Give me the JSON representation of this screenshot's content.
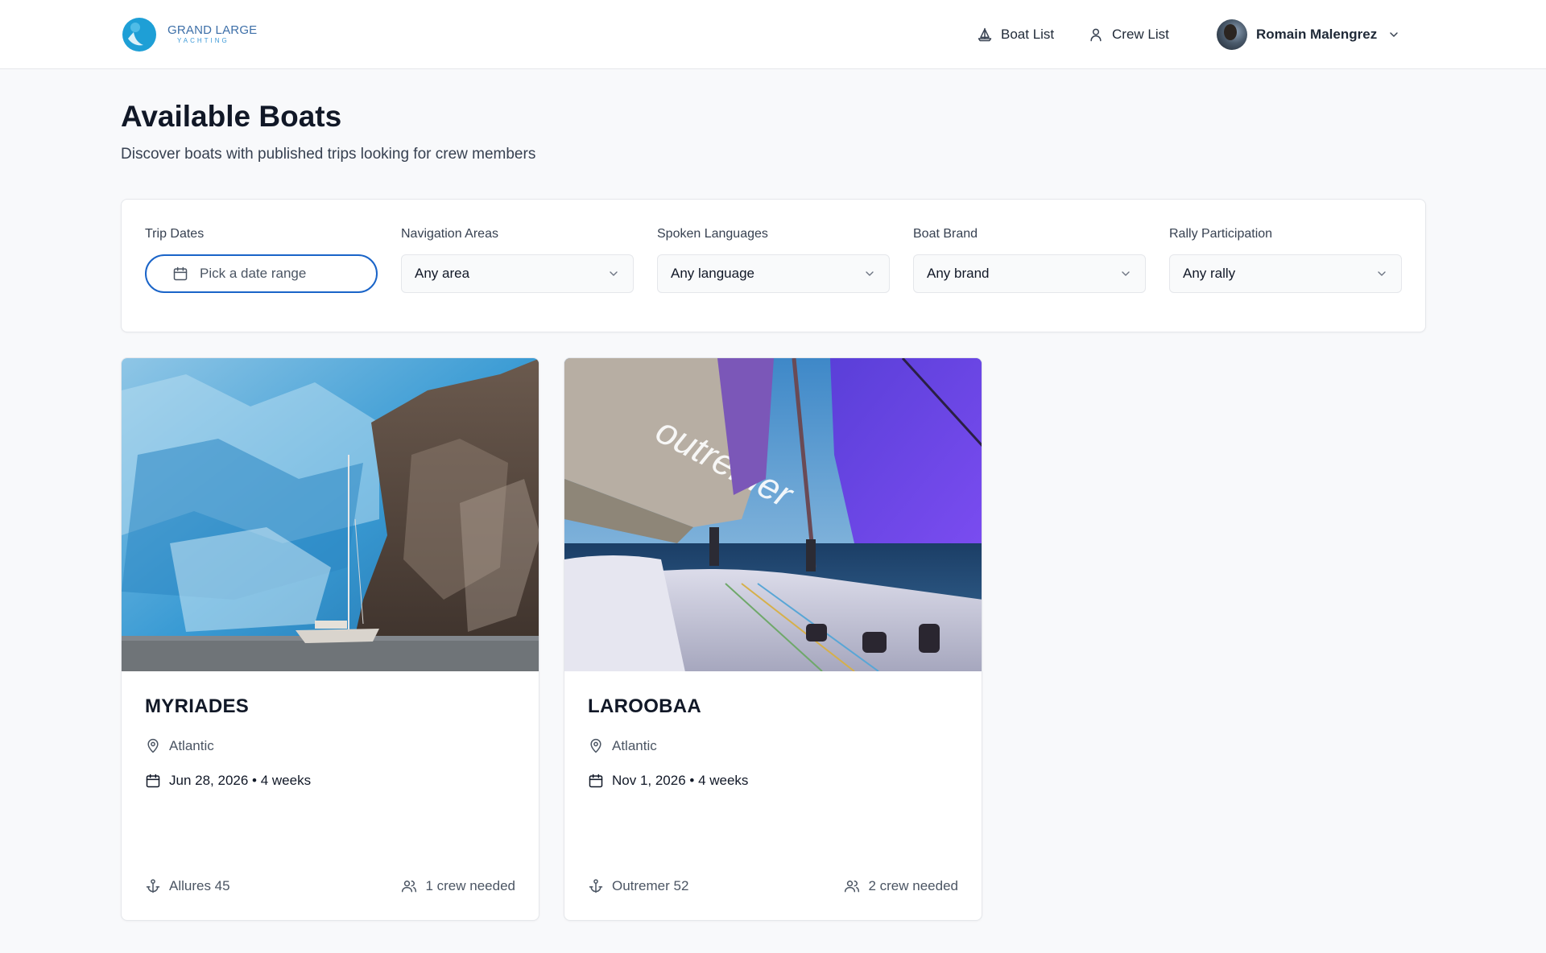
{
  "brand": {
    "line1": "GRAND LARGE",
    "line2": "YACHTING"
  },
  "nav": {
    "boat_list": "Boat List",
    "crew_list": "Crew List"
  },
  "user": {
    "name": "Romain Malengrez"
  },
  "page": {
    "title": "Available Boats",
    "subtitle": "Discover boats with published trips looking for crew members"
  },
  "filters": {
    "trip_dates": {
      "label": "Trip Dates",
      "placeholder": "Pick a date range"
    },
    "navigation_areas": {
      "label": "Navigation Areas",
      "value": "Any area"
    },
    "spoken_languages": {
      "label": "Spoken Languages",
      "value": "Any language"
    },
    "boat_brand": {
      "label": "Boat Brand",
      "value": "Any brand"
    },
    "rally_participation": {
      "label": "Rally Participation",
      "value": "Any rally"
    }
  },
  "boats": [
    {
      "name": "MYRIADES",
      "area": "Atlantic",
      "trip": "Jun 28, 2026 • 4 weeks",
      "model": "Allures 45",
      "crew": "1 crew needed",
      "image": "glacier-sailboat-photo"
    },
    {
      "name": "LAROOBAA",
      "area": "Atlantic",
      "trip": "Nov 1, 2026 • 4 weeks",
      "model": "Outremer 52",
      "crew": "2 crew needed",
      "image": "catamaran-deck-sail-photo"
    }
  ],
  "colors": {
    "accent": "#1a64c8",
    "background": "#f8f9fb",
    "card": "#ffffff",
    "border": "#e5e7eb"
  }
}
